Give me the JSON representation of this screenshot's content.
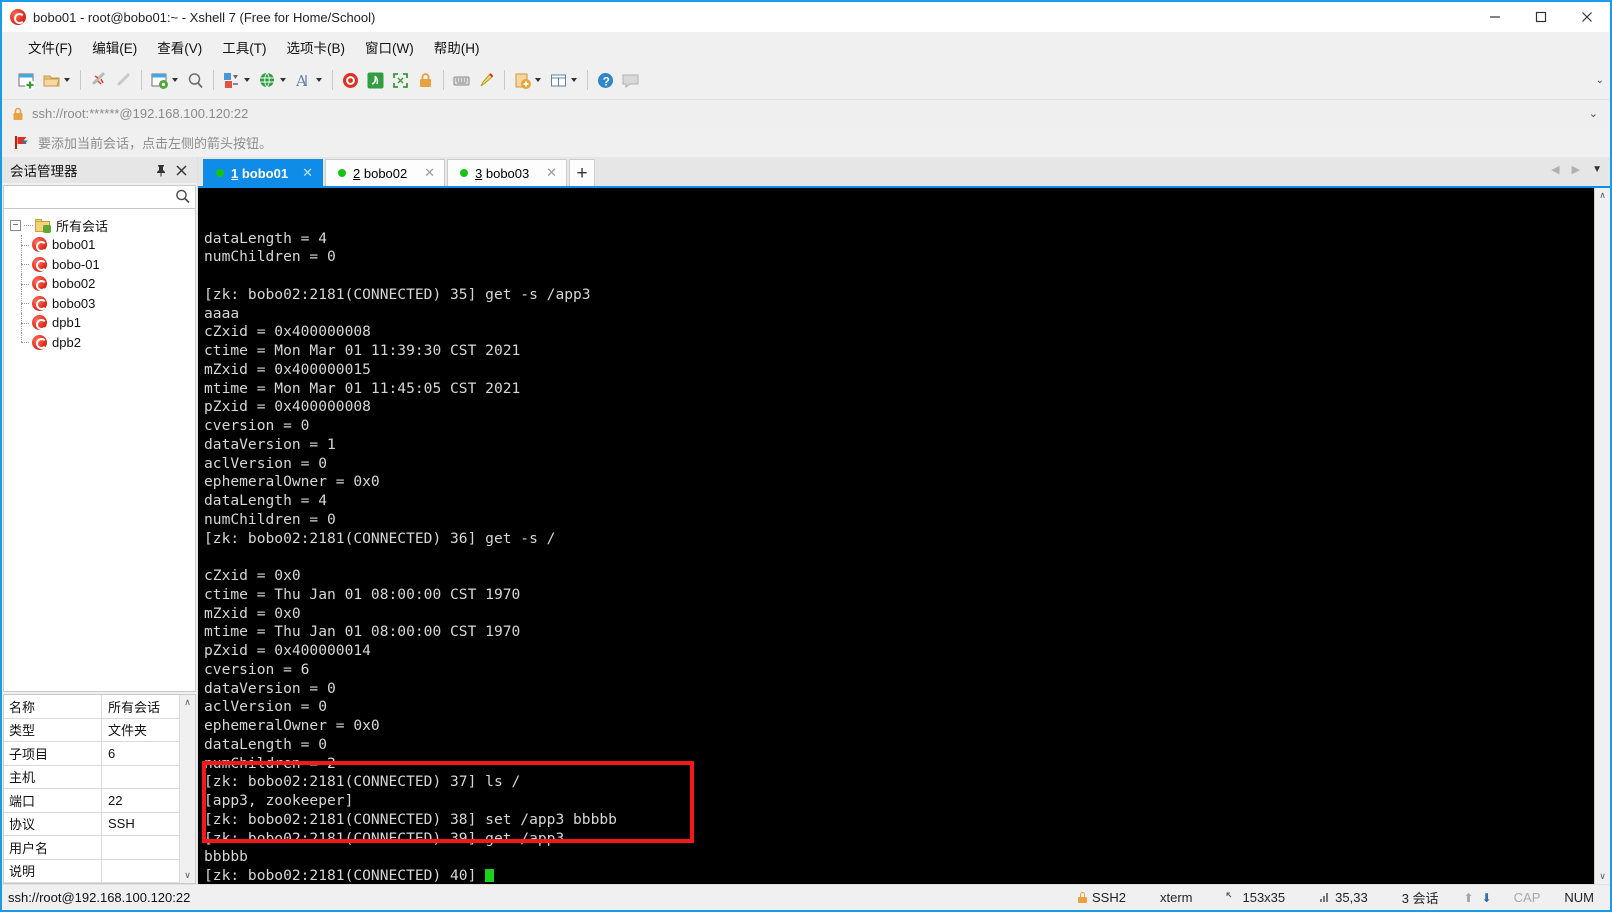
{
  "window": {
    "title": "bobo01 - root@bobo01:~ - Xshell 7 (Free for Home/School)",
    "icon": "xshell-logo-icon",
    "minimize_label": "—",
    "maximize_label": "□",
    "close_label": "✕"
  },
  "menu": {
    "items": [
      {
        "label": "文件(F)",
        "name": "menu-file"
      },
      {
        "label": "编辑(E)",
        "name": "menu-edit"
      },
      {
        "label": "查看(V)",
        "name": "menu-view"
      },
      {
        "label": "工具(T)",
        "name": "menu-tools"
      },
      {
        "label": "选项卡(B)",
        "name": "menu-tabs"
      },
      {
        "label": "窗口(W)",
        "name": "menu-window"
      },
      {
        "label": "帮助(H)",
        "name": "menu-help"
      }
    ]
  },
  "toolbar": {
    "overflow_caret": "⌄",
    "buttons": [
      "new-session-icon",
      "open-folder-icon",
      "disconnect-icon",
      "reconnect-icon",
      "session-properties-icon",
      "find-icon",
      "transfer-icon",
      "globe-icon",
      "font-icon",
      "xshell-icon",
      "xftp-icon",
      "fullscreen-icon",
      "lock-icon",
      "keyboard-icon",
      "highlight-icon",
      "add-folder-icon",
      "layout-icon",
      "help-icon",
      "comment-icon"
    ]
  },
  "address_bar": {
    "icon": "lock-icon",
    "value": "ssh://root:******@192.168.100.120:22",
    "caret": "⌄"
  },
  "hint_bar": {
    "icon": "red-flag-icon",
    "text": "要添加当前会话，点击左侧的箭头按钮。"
  },
  "sidebar": {
    "title": "会话管理器",
    "pin_icon": "pin-icon",
    "close_icon": "close-icon",
    "search": {
      "value": "",
      "placeholder": "",
      "icon": "search-icon"
    },
    "tree": {
      "root_label": "所有会话",
      "expander": "−",
      "items": [
        {
          "label": "bobo01"
        },
        {
          "label": "bobo-01"
        },
        {
          "label": "bobo02"
        },
        {
          "label": "bobo03"
        },
        {
          "label": "dpb1"
        },
        {
          "label": "dpb2"
        }
      ]
    },
    "properties": {
      "rows": [
        {
          "key": "名称",
          "value": "所有会话"
        },
        {
          "key": "类型",
          "value": "文件夹"
        },
        {
          "key": "子项目",
          "value": "6"
        },
        {
          "key": "主机",
          "value": ""
        },
        {
          "key": "端口",
          "value": "22"
        },
        {
          "key": "协议",
          "value": "SSH"
        },
        {
          "key": "用户名",
          "value": ""
        },
        {
          "key": "说明",
          "value": ""
        }
      ],
      "scroll_up": "∧",
      "scroll_down": "∨"
    }
  },
  "tabs": {
    "items": [
      {
        "index": "1",
        "label": "bobo01",
        "active": true,
        "close": "✕"
      },
      {
        "index": "2",
        "label": "bobo02",
        "active": false,
        "close": "✕"
      },
      {
        "index": "3",
        "label": "bobo03",
        "active": false,
        "close": "✕"
      }
    ],
    "add_label": "+",
    "nav_prev": "◀",
    "nav_next": "▶",
    "nav_caret": "▼"
  },
  "terminal": {
    "lines": [
      "dataLength = 4",
      "numChildren = 0",
      "",
      "[zk: bobo02:2181(CONNECTED) 35] get -s /app3",
      "aaaa",
      "cZxid = 0x400000008",
      "ctime = Mon Mar 01 11:39:30 CST 2021",
      "mZxid = 0x400000015",
      "mtime = Mon Mar 01 11:45:05 CST 2021",
      "pZxid = 0x400000008",
      "cversion = 0",
      "dataVersion = 1",
      "aclVersion = 0",
      "ephemeralOwner = 0x0",
      "dataLength = 4",
      "numChildren = 0",
      "[zk: bobo02:2181(CONNECTED) 36] get -s /",
      "",
      "cZxid = 0x0",
      "ctime = Thu Jan 01 08:00:00 CST 1970",
      "mZxid = 0x0",
      "mtime = Thu Jan 01 08:00:00 CST 1970",
      "pZxid = 0x400000014",
      "cversion = 6",
      "dataVersion = 0",
      "aclVersion = 0",
      "ephemeralOwner = 0x0",
      "dataLength = 0",
      "numChildren = 2",
      "[zk: bobo02:2181(CONNECTED) 37] ls /",
      "[app3, zookeeper]",
      "[zk: bobo02:2181(CONNECTED) 38] set /app3 bbbbb",
      "[zk: bobo02:2181(CONNECTED) 39] get /app3",
      "bbbbb",
      "[zk: bobo02:2181(CONNECTED) 40] "
    ],
    "cursor": "block-cursor",
    "annotation": {
      "name": "red-highlight-box",
      "color": "#f51818"
    },
    "scroll_up": "∧",
    "scroll_down": "∨"
  },
  "status_bar": {
    "left": "ssh://root@192.168.100.120:22",
    "protocol": "SSH2",
    "terminal_type": "xterm",
    "size": "153x35",
    "cursor_pos": "35,33",
    "sessions": "3 会话",
    "cap": "CAP",
    "num": "NUM",
    "size_icon": "resize-icon",
    "pos_icon": "cursor-pos-icon",
    "lock_icon": "lock-icon",
    "up_icon": "upload-arrow-icon",
    "down_icon": "download-arrow-icon"
  },
  "colors": {
    "accent": "#0f8ce8",
    "terminal_bg": "#000000",
    "terminal_fg": "#d6d6d6",
    "cursor": "#19d219",
    "annotation": "#f51818",
    "tab_dot": "#15c415"
  }
}
